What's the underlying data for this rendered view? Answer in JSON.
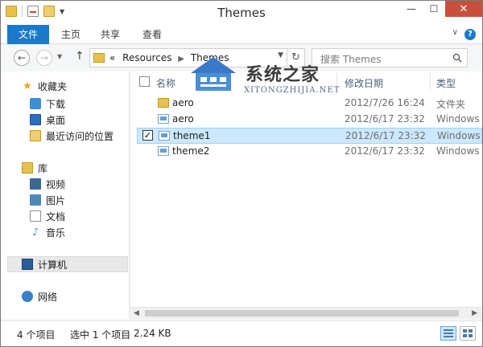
{
  "window": {
    "title": "Themes",
    "controls": {
      "minimize": "—",
      "maximize": "☐",
      "close": "✕"
    }
  },
  "ribbon": {
    "tabs": [
      "文件",
      "主页",
      "共享",
      "查看"
    ]
  },
  "nav": {
    "address": {
      "prefix": "«",
      "segments": [
        "Resources",
        "Themes"
      ]
    },
    "search_placeholder": "搜索 Themes"
  },
  "sidebar": {
    "favorites": {
      "label": "收藏夹",
      "items": [
        "下载",
        "桌面",
        "最近访问的位置"
      ]
    },
    "libraries": {
      "label": "库",
      "items": [
        "视频",
        "图片",
        "文档",
        "音乐"
      ]
    },
    "computer": {
      "label": "计算机"
    },
    "network": {
      "label": "网络"
    }
  },
  "columns": {
    "name": "名称",
    "date": "修改日期",
    "type": "类型"
  },
  "files": [
    {
      "name": "aero",
      "date": "2012/7/26 16:24",
      "type": "文件夹",
      "icon": "folder",
      "selected": false
    },
    {
      "name": "aero",
      "date": "2012/6/17 23:32",
      "type": "Windows",
      "icon": "theme-file",
      "selected": false
    },
    {
      "name": "theme1",
      "date": "2012/6/17 23:32",
      "type": "Windows",
      "icon": "theme-file",
      "selected": true
    },
    {
      "name": "theme2",
      "date": "2012/6/17 23:32",
      "type": "Windows",
      "icon": "theme-file",
      "selected": false
    }
  ],
  "watermark": {
    "title": "系统之家",
    "subtitle": "XITONGZHIJIA.NET"
  },
  "status": {
    "item_count": "4 个项目",
    "selected": "选中 1 个项目",
    "size": "2.24 KB"
  },
  "colors": {
    "accent": "#1979ca",
    "selection": "#cce8ff",
    "close": "#c7503d"
  }
}
